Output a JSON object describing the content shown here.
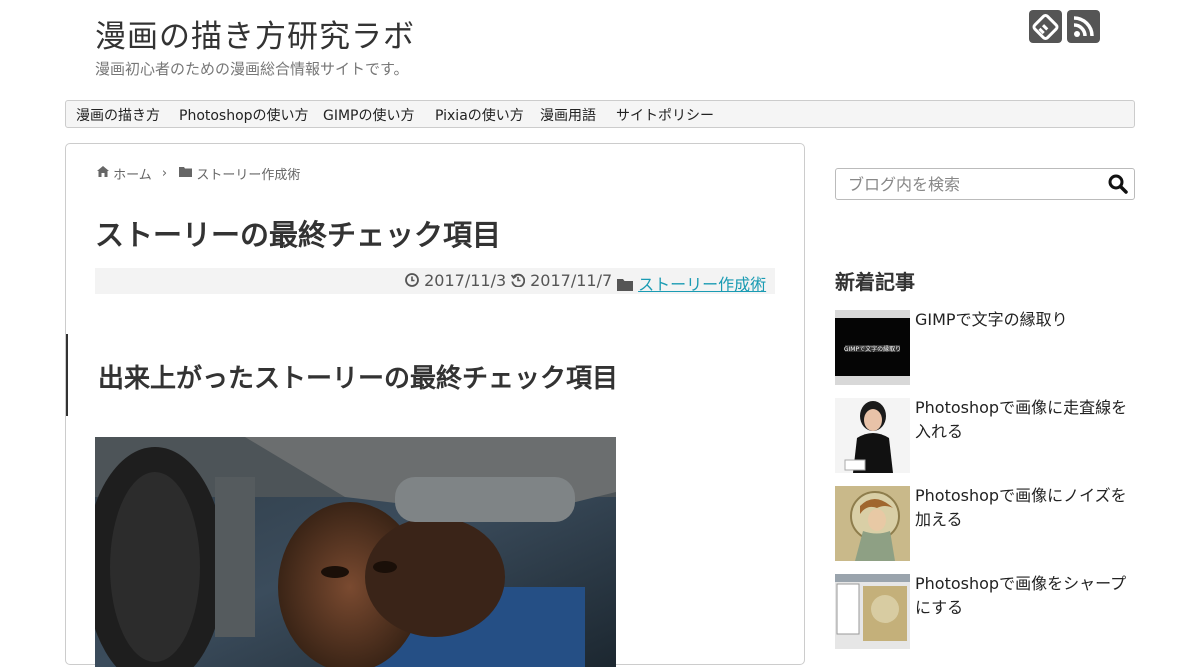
{
  "site": {
    "title": "漫画の描き方研究ラボ",
    "description": "漫画初心者のための漫画総合情報サイトです。"
  },
  "header_icons": [
    "feedly-icon",
    "rss-icon"
  ],
  "nav": {
    "items": [
      "漫画の描き方",
      "Photoshopの使い方",
      "GIMPの使い方",
      "Pixiaの使い方",
      "漫画用語",
      "サイトポリシー"
    ]
  },
  "breadcrumb": {
    "home": "ホーム",
    "category": "ストーリー作成術"
  },
  "article": {
    "title": "ストーリーの最終チェック項目",
    "published": "2017/11/3",
    "updated": "2017/11/7",
    "category": "ストーリー作成術",
    "heading": "出来上がったストーリーの最終チェック項目"
  },
  "sidebar": {
    "search_placeholder": "ブログ内を検索",
    "recent_heading": "新着記事",
    "recent_posts": [
      {
        "title": "GIMPで文字の縁取り",
        "thumb_text": "GIMPで文字の縁取り"
      },
      {
        "title": "Photoshopで画像に走査線を入れる"
      },
      {
        "title": "Photoshopで画像にノイズを加える"
      },
      {
        "title": "Photoshopで画像をシャープにする"
      }
    ]
  },
  "colors": {
    "accent": "#1a9bb3",
    "icon_bg": "#555555",
    "meta_bg": "#f3f3f3"
  }
}
